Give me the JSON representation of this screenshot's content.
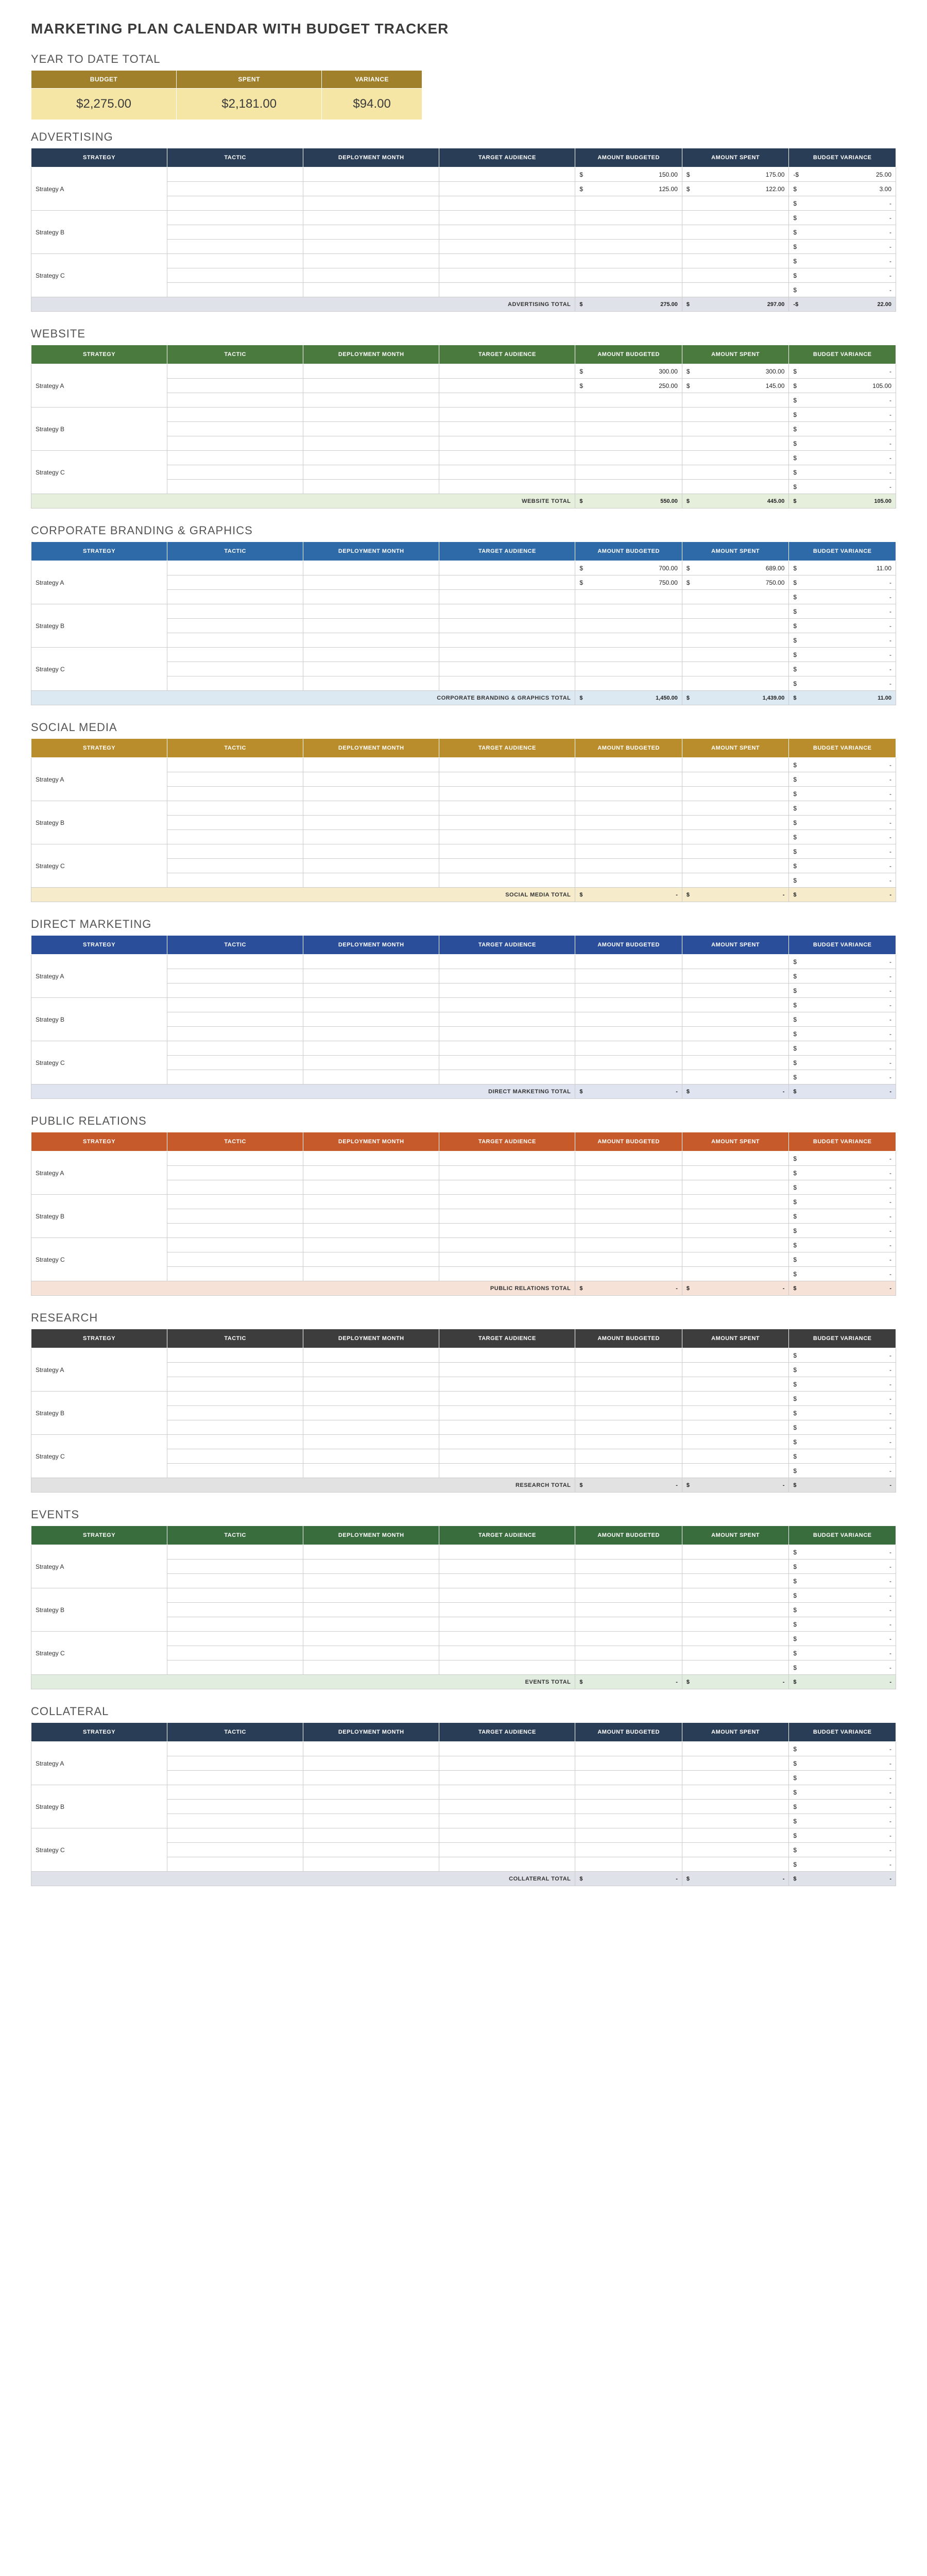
{
  "title": "MARKETING PLAN CALENDAR WITH BUDGET TRACKER",
  "ytd": {
    "label": "YEAR TO DATE TOTAL",
    "headers": {
      "budget": "BUDGET",
      "spent": "SPENT",
      "variance": "VARIANCE"
    },
    "values": {
      "budget": "$2,275.00",
      "spent": "$2,181.00",
      "variance": "$94.00"
    }
  },
  "columns": {
    "strategy": "STRATEGY",
    "tactic": "TACTIC",
    "month": "DEPLOYMENT MONTH",
    "target": "TARGET AUDIENCE",
    "budgeted": "AMOUNT BUDGETED",
    "spent": "AMOUNT SPENT",
    "variance": "BUDGET VARIANCE"
  },
  "strategies": [
    "Strategy A",
    "Strategy B",
    "Strategy C"
  ],
  "sections": [
    {
      "id": "advertising",
      "title": "ADVERTISING",
      "header_class": "hdr-advertising",
      "total_class": "tot-advertising",
      "total_label": "ADVERTISING TOTAL",
      "rows": [
        {
          "budgeted": "150.00",
          "spent": "175.00",
          "variance_prefix": "-$",
          "variance": "25.00"
        },
        {
          "budgeted": "125.00",
          "spent": "122.00",
          "variance_prefix": "$",
          "variance": "3.00"
        },
        {
          "budgeted": "",
          "spent": "",
          "variance_prefix": "$",
          "variance": "-"
        },
        {
          "budgeted": "",
          "spent": "",
          "variance_prefix": "$",
          "variance": "-"
        },
        {
          "budgeted": "",
          "spent": "",
          "variance_prefix": "$",
          "variance": "-"
        },
        {
          "budgeted": "",
          "spent": "",
          "variance_prefix": "$",
          "variance": "-"
        },
        {
          "budgeted": "",
          "spent": "",
          "variance_prefix": "$",
          "variance": "-"
        },
        {
          "budgeted": "",
          "spent": "",
          "variance_prefix": "$",
          "variance": "-"
        },
        {
          "budgeted": "",
          "spent": "",
          "variance_prefix": "$",
          "variance": "-"
        }
      ],
      "totals": {
        "budgeted": "275.00",
        "spent": "297.00",
        "variance_prefix": "-$",
        "variance": "22.00"
      }
    },
    {
      "id": "website",
      "title": "WEBSITE",
      "header_class": "hdr-website",
      "total_class": "tot-website",
      "total_label": "WEBSITE TOTAL",
      "rows": [
        {
          "budgeted": "300.00",
          "spent": "300.00",
          "variance_prefix": "$",
          "variance": "-"
        },
        {
          "budgeted": "250.00",
          "spent": "145.00",
          "variance_prefix": "$",
          "variance": "105.00"
        },
        {
          "budgeted": "",
          "spent": "",
          "variance_prefix": "$",
          "variance": "-"
        },
        {
          "budgeted": "",
          "spent": "",
          "variance_prefix": "$",
          "variance": "-"
        },
        {
          "budgeted": "",
          "spent": "",
          "variance_prefix": "$",
          "variance": "-"
        },
        {
          "budgeted": "",
          "spent": "",
          "variance_prefix": "$",
          "variance": "-"
        },
        {
          "budgeted": "",
          "spent": "",
          "variance_prefix": "$",
          "variance": "-"
        },
        {
          "budgeted": "",
          "spent": "",
          "variance_prefix": "$",
          "variance": "-"
        },
        {
          "budgeted": "",
          "spent": "",
          "variance_prefix": "$",
          "variance": "-"
        }
      ],
      "totals": {
        "budgeted": "550.00",
        "spent": "445.00",
        "variance_prefix": "$",
        "variance": "105.00"
      }
    },
    {
      "id": "corporate",
      "title": "CORPORATE BRANDING & GRAPHICS",
      "header_class": "hdr-corporate",
      "total_class": "tot-corporate",
      "total_label": "CORPORATE BRANDING & GRAPHICS TOTAL",
      "rows": [
        {
          "budgeted": "700.00",
          "spent": "689.00",
          "variance_prefix": "$",
          "variance": "11.00"
        },
        {
          "budgeted": "750.00",
          "spent": "750.00",
          "variance_prefix": "$",
          "variance": "-"
        },
        {
          "budgeted": "",
          "spent": "",
          "variance_prefix": "$",
          "variance": "-"
        },
        {
          "budgeted": "",
          "spent": "",
          "variance_prefix": "$",
          "variance": "-"
        },
        {
          "budgeted": "",
          "spent": "",
          "variance_prefix": "$",
          "variance": "-"
        },
        {
          "budgeted": "",
          "spent": "",
          "variance_prefix": "$",
          "variance": "-"
        },
        {
          "budgeted": "",
          "spent": "",
          "variance_prefix": "$",
          "variance": "-"
        },
        {
          "budgeted": "",
          "spent": "",
          "variance_prefix": "$",
          "variance": "-"
        },
        {
          "budgeted": "",
          "spent": "",
          "variance_prefix": "$",
          "variance": "-"
        }
      ],
      "totals": {
        "budgeted": "1,450.00",
        "spent": "1,439.00",
        "variance_prefix": "$",
        "variance": "11.00"
      }
    },
    {
      "id": "social",
      "title": "SOCIAL MEDIA",
      "header_class": "hdr-social",
      "total_class": "tot-social",
      "total_label": "SOCIAL MEDIA TOTAL",
      "rows": [
        {
          "budgeted": "",
          "spent": "",
          "variance_prefix": "$",
          "variance": "-"
        },
        {
          "budgeted": "",
          "spent": "",
          "variance_prefix": "$",
          "variance": "-"
        },
        {
          "budgeted": "",
          "spent": "",
          "variance_prefix": "$",
          "variance": "-"
        },
        {
          "budgeted": "",
          "spent": "",
          "variance_prefix": "$",
          "variance": "-"
        },
        {
          "budgeted": "",
          "spent": "",
          "variance_prefix": "$",
          "variance": "-"
        },
        {
          "budgeted": "",
          "spent": "",
          "variance_prefix": "$",
          "variance": "-"
        },
        {
          "budgeted": "",
          "spent": "",
          "variance_prefix": "$",
          "variance": "-"
        },
        {
          "budgeted": "",
          "spent": "",
          "variance_prefix": "$",
          "variance": "-"
        },
        {
          "budgeted": "",
          "spent": "",
          "variance_prefix": "$",
          "variance": "-"
        }
      ],
      "totals": {
        "budgeted": "-",
        "spent": "-",
        "variance_prefix": "$",
        "variance": "-"
      }
    },
    {
      "id": "direct",
      "title": "DIRECT MARKETING",
      "header_class": "hdr-direct",
      "total_class": "tot-direct",
      "total_label": "DIRECT MARKETING TOTAL",
      "rows": [
        {
          "budgeted": "",
          "spent": "",
          "variance_prefix": "$",
          "variance": "-"
        },
        {
          "budgeted": "",
          "spent": "",
          "variance_prefix": "$",
          "variance": "-"
        },
        {
          "budgeted": "",
          "spent": "",
          "variance_prefix": "$",
          "variance": "-"
        },
        {
          "budgeted": "",
          "spent": "",
          "variance_prefix": "$",
          "variance": "-"
        },
        {
          "budgeted": "",
          "spent": "",
          "variance_prefix": "$",
          "variance": "-"
        },
        {
          "budgeted": "",
          "spent": "",
          "variance_prefix": "$",
          "variance": "-"
        },
        {
          "budgeted": "",
          "spent": "",
          "variance_prefix": "$",
          "variance": "-"
        },
        {
          "budgeted": "",
          "spent": "",
          "variance_prefix": "$",
          "variance": "-"
        },
        {
          "budgeted": "",
          "spent": "",
          "variance_prefix": "$",
          "variance": "-"
        }
      ],
      "totals": {
        "budgeted": "-",
        "spent": "-",
        "variance_prefix": "$",
        "variance": "-"
      }
    },
    {
      "id": "public",
      "title": "PUBLIC RELATIONS",
      "header_class": "hdr-public",
      "total_class": "tot-public",
      "total_label": "PUBLIC RELATIONS TOTAL",
      "rows": [
        {
          "budgeted": "",
          "spent": "",
          "variance_prefix": "$",
          "variance": "-"
        },
        {
          "budgeted": "",
          "spent": "",
          "variance_prefix": "$",
          "variance": "-"
        },
        {
          "budgeted": "",
          "spent": "",
          "variance_prefix": "$",
          "variance": "-"
        },
        {
          "budgeted": "",
          "spent": "",
          "variance_prefix": "$",
          "variance": "-"
        },
        {
          "budgeted": "",
          "spent": "",
          "variance_prefix": "$",
          "variance": "-"
        },
        {
          "budgeted": "",
          "spent": "",
          "variance_prefix": "$",
          "variance": "-"
        },
        {
          "budgeted": "",
          "spent": "",
          "variance_prefix": "$",
          "variance": "-"
        },
        {
          "budgeted": "",
          "spent": "",
          "variance_prefix": "$",
          "variance": "-"
        },
        {
          "budgeted": "",
          "spent": "",
          "variance_prefix": "$",
          "variance": "-"
        }
      ],
      "totals": {
        "budgeted": "-",
        "spent": "-",
        "variance_prefix": "$",
        "variance": "-"
      }
    },
    {
      "id": "research",
      "title": "RESEARCH",
      "header_class": "hdr-research",
      "total_class": "tot-research",
      "total_label": "RESEARCH TOTAL",
      "rows": [
        {
          "budgeted": "",
          "spent": "",
          "variance_prefix": "$",
          "variance": "-"
        },
        {
          "budgeted": "",
          "spent": "",
          "variance_prefix": "$",
          "variance": "-"
        },
        {
          "budgeted": "",
          "spent": "",
          "variance_prefix": "$",
          "variance": "-"
        },
        {
          "budgeted": "",
          "spent": "",
          "variance_prefix": "$",
          "variance": "-"
        },
        {
          "budgeted": "",
          "spent": "",
          "variance_prefix": "$",
          "variance": "-"
        },
        {
          "budgeted": "",
          "spent": "",
          "variance_prefix": "$",
          "variance": "-"
        },
        {
          "budgeted": "",
          "spent": "",
          "variance_prefix": "$",
          "variance": "-"
        },
        {
          "budgeted": "",
          "spent": "",
          "variance_prefix": "$",
          "variance": "-"
        },
        {
          "budgeted": "",
          "spent": "",
          "variance_prefix": "$",
          "variance": "-"
        }
      ],
      "totals": {
        "budgeted": "-",
        "spent": "-",
        "variance_prefix": "$",
        "variance": "-"
      }
    },
    {
      "id": "events",
      "title": "EVENTS",
      "header_class": "hdr-events",
      "total_class": "tot-events",
      "total_label": "EVENTS TOTAL",
      "rows": [
        {
          "budgeted": "",
          "spent": "",
          "variance_prefix": "$",
          "variance": "-"
        },
        {
          "budgeted": "",
          "spent": "",
          "variance_prefix": "$",
          "variance": "-"
        },
        {
          "budgeted": "",
          "spent": "",
          "variance_prefix": "$",
          "variance": "-"
        },
        {
          "budgeted": "",
          "spent": "",
          "variance_prefix": "$",
          "variance": "-"
        },
        {
          "budgeted": "",
          "spent": "",
          "variance_prefix": "$",
          "variance": "-"
        },
        {
          "budgeted": "",
          "spent": "",
          "variance_prefix": "$",
          "variance": "-"
        },
        {
          "budgeted": "",
          "spent": "",
          "variance_prefix": "$",
          "variance": "-"
        },
        {
          "budgeted": "",
          "spent": "",
          "variance_prefix": "$",
          "variance": "-"
        },
        {
          "budgeted": "",
          "spent": "",
          "variance_prefix": "$",
          "variance": "-"
        }
      ],
      "totals": {
        "budgeted": "-",
        "spent": "-",
        "variance_prefix": "$",
        "variance": "-"
      }
    },
    {
      "id": "collateral",
      "title": "COLLATERAL",
      "header_class": "hdr-collateral",
      "total_class": "tot-collateral",
      "total_label": "COLLATERAL TOTAL",
      "rows": [
        {
          "budgeted": "",
          "spent": "",
          "variance_prefix": "$",
          "variance": "-"
        },
        {
          "budgeted": "",
          "spent": "",
          "variance_prefix": "$",
          "variance": "-"
        },
        {
          "budgeted": "",
          "spent": "",
          "variance_prefix": "$",
          "variance": "-"
        },
        {
          "budgeted": "",
          "spent": "",
          "variance_prefix": "$",
          "variance": "-"
        },
        {
          "budgeted": "",
          "spent": "",
          "variance_prefix": "$",
          "variance": "-"
        },
        {
          "budgeted": "",
          "spent": "",
          "variance_prefix": "$",
          "variance": "-"
        },
        {
          "budgeted": "",
          "spent": "",
          "variance_prefix": "$",
          "variance": "-"
        },
        {
          "budgeted": "",
          "spent": "",
          "variance_prefix": "$",
          "variance": "-"
        },
        {
          "budgeted": "",
          "spent": "",
          "variance_prefix": "$",
          "variance": "-"
        }
      ],
      "totals": {
        "budgeted": "-",
        "spent": "-",
        "variance_prefix": "$",
        "variance": "-"
      }
    }
  ]
}
